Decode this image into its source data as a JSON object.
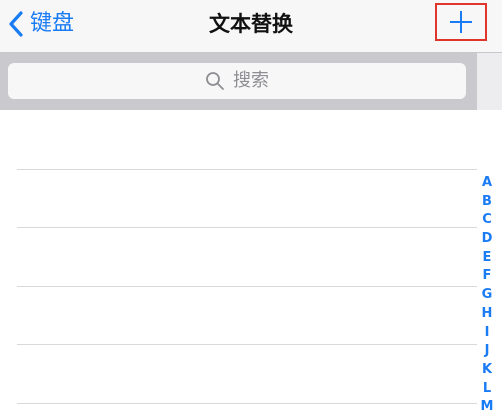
{
  "navbar": {
    "back_label": "键盘",
    "title": "文本替换",
    "add_icon": "plus-icon",
    "back_icon": "chevron-left-icon",
    "highlight_color": "#e0352b"
  },
  "search": {
    "placeholder": "搜索",
    "icon": "search-icon"
  },
  "section_index": [
    "A",
    "B",
    "C",
    "D",
    "E",
    "F",
    "G",
    "H",
    "I",
    "J",
    "K",
    "L",
    "M"
  ],
  "colors": {
    "accent": "#1a7cf5",
    "nav_background": "#f7f7f7",
    "search_background": "#c9c9ce"
  }
}
